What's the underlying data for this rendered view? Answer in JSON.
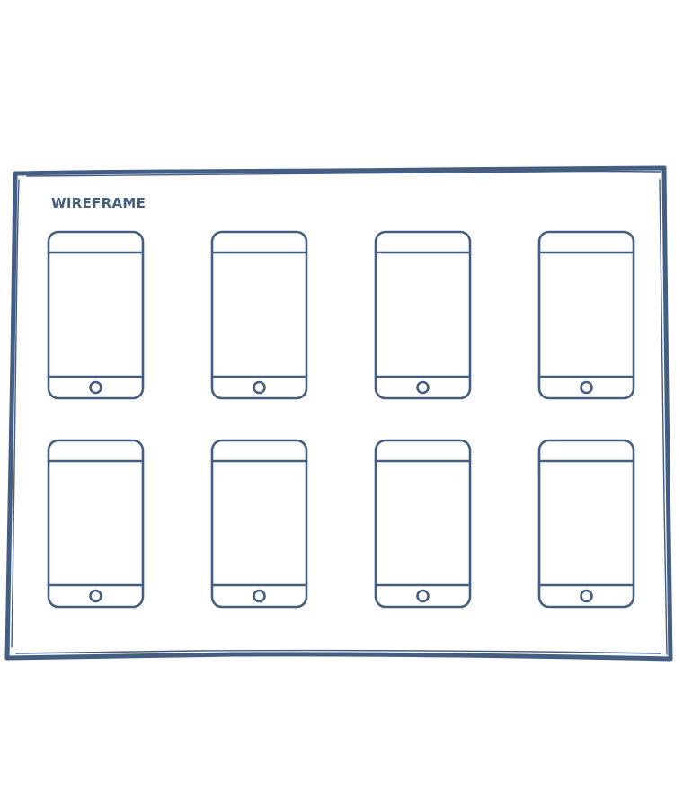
{
  "board": {
    "title": "WIREFRAME"
  },
  "phones": {
    "rows": 2,
    "columns": 4,
    "count": 8
  },
  "colors": {
    "stroke": "#445d82",
    "background": "#ffffff"
  }
}
